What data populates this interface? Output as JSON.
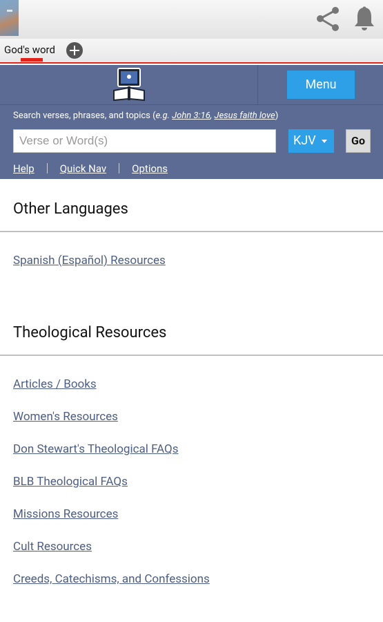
{
  "browser": {
    "tab_label": "God's word"
  },
  "header": {
    "menu_label": "Menu",
    "search_hint_prefix": "Search verses, phrases, and topics (",
    "search_hint_eg": "e.g. ",
    "search_hint_ex1": "John 3:16",
    "search_hint_comma": ", ",
    "search_hint_ex2": "Jesus faith love",
    "search_hint_suffix": ")",
    "search_placeholder": "Verse or Word(s)",
    "version": "KJV",
    "go_label": "Go",
    "links": [
      "Help",
      "Quick Nav",
      "Options"
    ]
  },
  "sections": [
    {
      "title": "Other Languages",
      "links": [
        "Spanish (Español) Resources"
      ]
    },
    {
      "title": "Theological Resources",
      "links": [
        "Articles / Books",
        "Women's Resources",
        "Don Stewart's Theological FAQs",
        "BLB Theological FAQs",
        "Missions Resources",
        "Cult Resources",
        "Creeds, Catechisms, and Confessions"
      ]
    }
  ],
  "colors": {
    "header_bg": "#5b6b93",
    "accent_blue": "#2da0e7",
    "tab_underline": "#e2231a",
    "link": "#4d5e84"
  }
}
